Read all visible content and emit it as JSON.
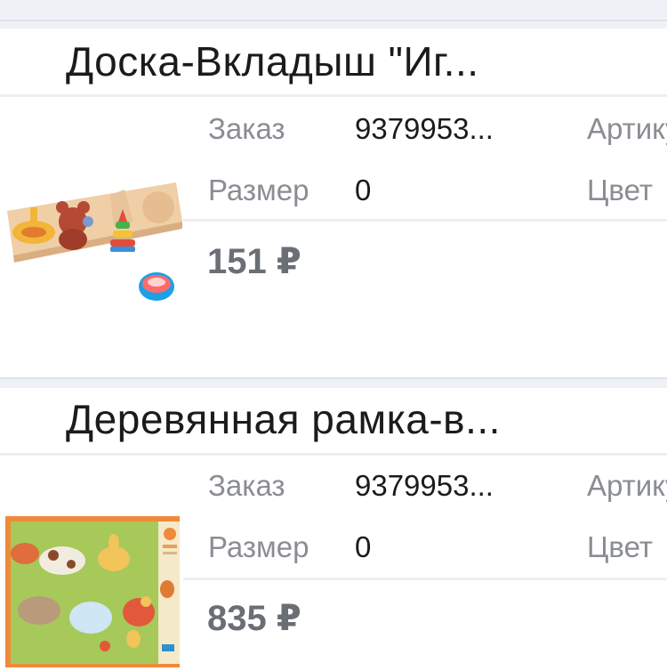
{
  "items": [
    {
      "title": "Доска-Вкладыш \"Иг...",
      "image_icon": "wooden-insert-board-image",
      "order_label": "Заказ",
      "order_value": "9379953...",
      "article_label": "Артикул",
      "size_label": "Размер",
      "size_value": "0",
      "color_label": "Цвет",
      "price": "151 ₽"
    },
    {
      "title": "Деревянная рамка-в...",
      "image_icon": "animal-puzzle-frame-image",
      "order_label": "Заказ",
      "order_value": "9379953...",
      "article_label": "Артикул",
      "size_label": "Размер",
      "size_value": "0",
      "color_label": "Цвет",
      "price": "835 ₽"
    }
  ]
}
